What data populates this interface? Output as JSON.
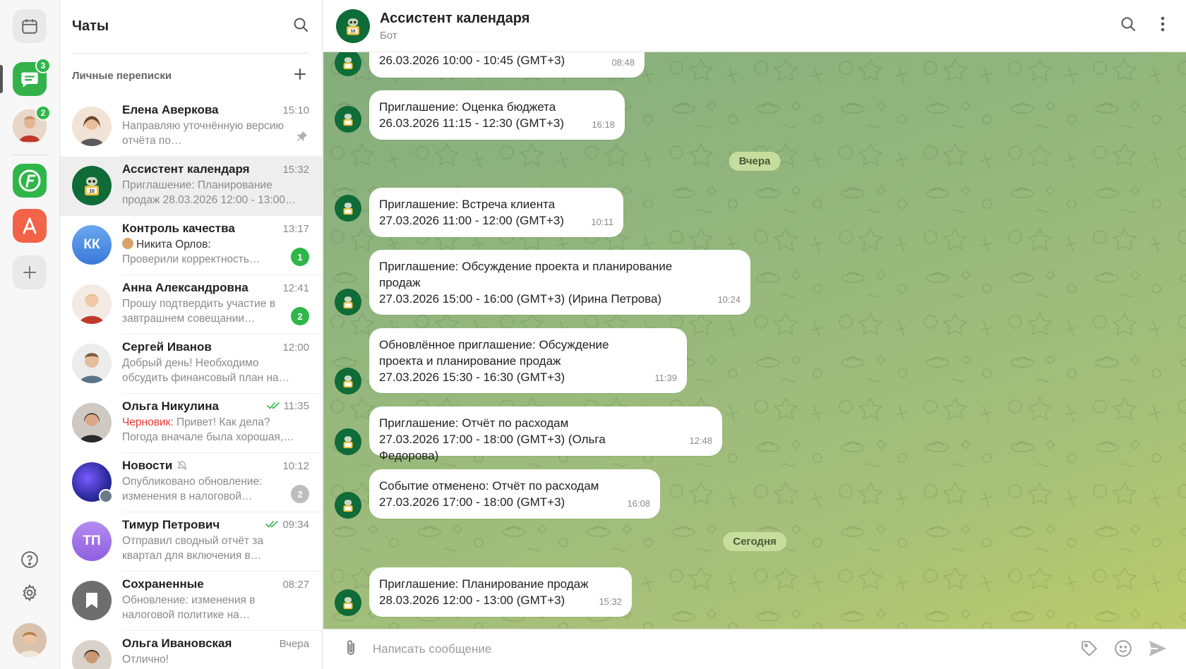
{
  "rail": {
    "chats_badge": "3",
    "user_badge": "2"
  },
  "list": {
    "title": "Чаты",
    "section_title": "Личные переписки",
    "chats": [
      {
        "name": "Елена Аверкова",
        "time": "15:10",
        "preview": "Направляю уточнённую версию отчёта по…",
        "pinned": true
      },
      {
        "name": "Ассистент календаря",
        "time": "15:32",
        "preview": "Приглашение: Планирование продаж 28.03.2026 12:00 - 13:00…",
        "active": true
      },
      {
        "name": "Контроль качества",
        "initials": "КК",
        "time": "13:17",
        "sender": "Никита Орлов:",
        "preview": "Проверили корректность…",
        "badge": "1"
      },
      {
        "name": "Анна Александровна",
        "time": "12:41",
        "preview": "Прошу подтвердить участие в завтрашнем совещании…",
        "badge": "2"
      },
      {
        "name": "Сергей Иванов",
        "time": "12:00",
        "preview": "Добрый день! Необходимо обсудить финансовый план на…"
      },
      {
        "name": "Ольга Никулина",
        "time": "11:35",
        "draft_label": "Черновик:",
        "preview": "Привет! Как дела? Погода вначале была хорошая,…",
        "read": true
      },
      {
        "name": "Новости",
        "time": "10:12",
        "preview": "Опубликовано обновление: изменения в налоговой…",
        "badge": "2",
        "muted": true
      },
      {
        "name": "Тимур Петрович",
        "initials": "ТП",
        "time": "09:34",
        "preview": "Отправил сводный отчёт за квартал для включения в…",
        "read": true
      },
      {
        "name": "Сохраненные",
        "time": "08:27",
        "preview": "Обновление: изменения в налоговой политике на…"
      },
      {
        "name": "Ольга Ивановская",
        "time": "Вчера",
        "preview": "Отлично!"
      }
    ]
  },
  "conversation": {
    "title": "Ассистент календаря",
    "subtitle": "Бот",
    "date_yesterday": "Вчера",
    "date_today": "Сегодня",
    "messages": [
      {
        "text": "26.03.2026 10:00 - 10:45 (GMT+3)",
        "time": "08:48"
      },
      {
        "text": "Приглашение: Оценка бюджета\n26.03.2026 11:15 - 12:30 (GMT+3)",
        "time": "16:18"
      },
      {
        "text": "Приглашение: Встреча клиента\n27.03.2026 11:00 - 12:00 (GMT+3)",
        "time": "10:11"
      },
      {
        "text": "Приглашение: Обсуждение проекта и планирование\nпродаж\n27.03.2026 15:00 - 16:00 (GMT+3) (Ирина Петрова)",
        "time": "10:24"
      },
      {
        "text": "Обновлённое приглашение: Обсуждение\nпроекта и планирование продаж\n27.03.2026 15:30 - 16:30 (GMT+3)",
        "time": "11:39"
      },
      {
        "text": "Приглашение: Отчёт по расходам\n27.03.2026 17:00 - 18:00 (GMT+3) (Ольга Федорова)",
        "time": "12:48"
      },
      {
        "text": "Событие отменено: Отчёт по расходам\n27.03.2026 17:00 - 18:00 (GMT+3)",
        "time": "16:08"
      },
      {
        "text": "Приглашение: Планирование продаж\n28.03.2026 12:00 - 13:00 (GMT+3)",
        "time": "15:32"
      }
    ],
    "composer_placeholder": "Написать сообщение"
  }
}
